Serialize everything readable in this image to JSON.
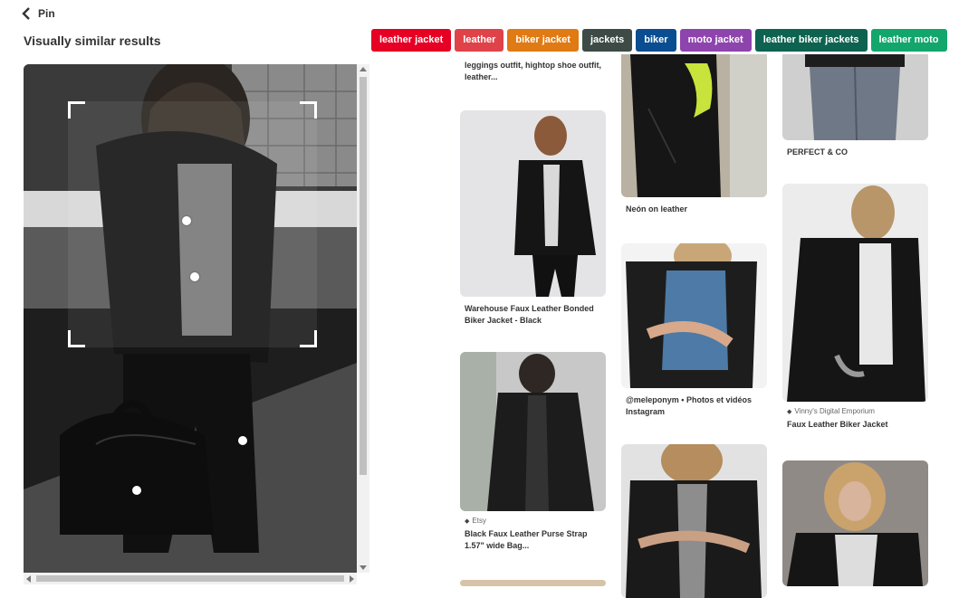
{
  "back": {
    "label": "Pin"
  },
  "page": {
    "title": "Visually similar results"
  },
  "tags": [
    {
      "label": "leather jacket",
      "color": "#e60023"
    },
    {
      "label": "leather",
      "color": "#e0424a"
    },
    {
      "label": "biker jacket",
      "color": "#e07a14"
    },
    {
      "label": "jackets",
      "color": "#3d4a46"
    },
    {
      "label": "biker",
      "color": "#0a4d91"
    },
    {
      "label": "moto jacket",
      "color": "#8e44ad"
    },
    {
      "label": "leather biker jackets",
      "color": "#0e6250"
    },
    {
      "label": "leather moto",
      "color": "#13a66c"
    }
  ],
  "results": {
    "col1": {
      "top_caption": "leggings outfit, hightop shoe outfit, leather...",
      "pin2": {
        "title": "Warehouse Faux Leather Bonded Biker Jacket - Black"
      },
      "pin3": {
        "source": "Etsy",
        "title": "Black Faux Leather Purse Strap 1.57\" wide Bag..."
      }
    },
    "col2": {
      "pin1": {
        "title": "Neón on leather"
      },
      "pin2": {
        "title": "@meleponym • Photos et vidéos Instagram"
      }
    },
    "col3": {
      "pin1": {
        "title": "PERFECT & CO"
      },
      "pin2": {
        "source": "Vinny's Digital Emporium",
        "title": "Faux Leather Biker Jacket"
      }
    }
  }
}
